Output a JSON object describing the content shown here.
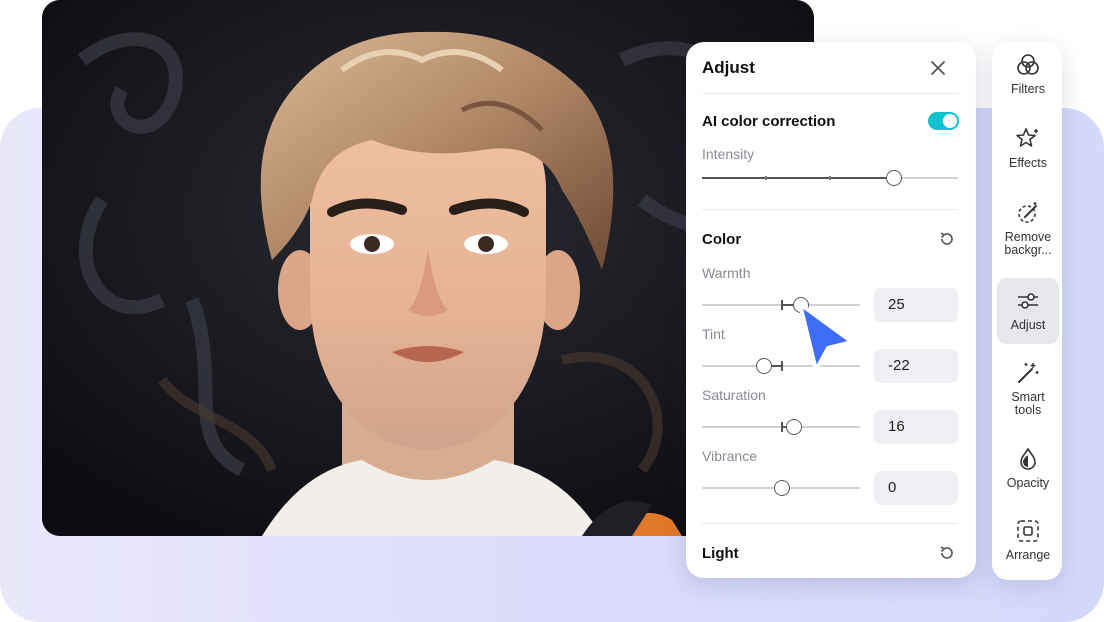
{
  "adjust_panel": {
    "title": "Adjust",
    "ai_color_correction": {
      "label": "AI color correction",
      "enabled": true
    },
    "intensity": {
      "label": "Intensity",
      "level_percent": 75
    },
    "color": {
      "title": "Color",
      "warmth": {
        "label": "Warmth",
        "value": "25"
      },
      "tint": {
        "label": "Tint",
        "value": "-22"
      },
      "saturation": {
        "label": "Saturation",
        "value": "16"
      },
      "vibrance": {
        "label": "Vibrance",
        "value": "0"
      }
    },
    "light": {
      "title": "Light"
    }
  },
  "toolbar": {
    "items": [
      {
        "label_1": "Filters",
        "label_2": "",
        "icon": "filters-icon"
      },
      {
        "label_1": "Effects",
        "label_2": "",
        "icon": "effects-icon"
      },
      {
        "label_1": "Remove",
        "label_2": "backgr...",
        "icon": "remove-background-icon"
      },
      {
        "label_1": "Adjust",
        "label_2": "",
        "icon": "adjust-icon",
        "active": true
      },
      {
        "label_1": "Smart",
        "label_2": "tools",
        "icon": "smart-tools-icon"
      },
      {
        "label_1": "Opacity",
        "label_2": "",
        "icon": "opacity-icon"
      },
      {
        "label_1": "Arrange",
        "label_2": "",
        "icon": "arrange-icon"
      }
    ]
  },
  "colors": {
    "accent_toggle": "#13c2cf",
    "cursor": "#3d6cf5",
    "background_panel": "#dcdcfa"
  }
}
